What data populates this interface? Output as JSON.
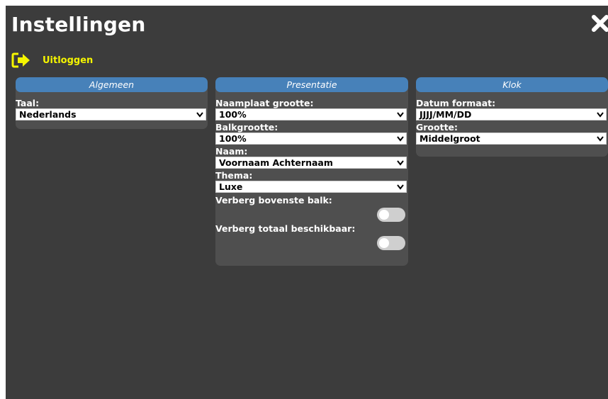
{
  "header": {
    "title": "Instellingen",
    "logout_label": "Uitloggen"
  },
  "panels": {
    "algemeen": {
      "title": "Algemeen",
      "taal_label": "Taal:",
      "taal_value": "Nederlands"
    },
    "presentatie": {
      "title": "Presentatie",
      "naamplaat_label": "Naamplaat grootte:",
      "naamplaat_value": "100%",
      "balk_label": "Balkgrootte:",
      "balk_value": "100%",
      "naam_label": "Naam:",
      "naam_value": "Voornaam Achternaam",
      "thema_label": "Thema:",
      "thema_value": "Luxe",
      "verberg_balk_label": "Verberg bovenste balk:",
      "verberg_balk_on": false,
      "verberg_totaal_label": "Verberg totaal beschikbaar:",
      "verberg_totaal_on": false
    },
    "klok": {
      "title": "Klok",
      "datum_label": "Datum formaat:",
      "datum_value": "JJJJ/MM/DD",
      "grootte_label": "Grootte:",
      "grootte_value": "Middelgroot"
    }
  },
  "colors": {
    "background": "#3c3c3c",
    "panel": "#4f4f4f",
    "panel_header": "#4781b9",
    "logout_accent": "#f5f500"
  },
  "icons": {
    "close": "close-icon",
    "logout": "logout-arrow-icon",
    "dropdown": "chevron-down-icon"
  }
}
